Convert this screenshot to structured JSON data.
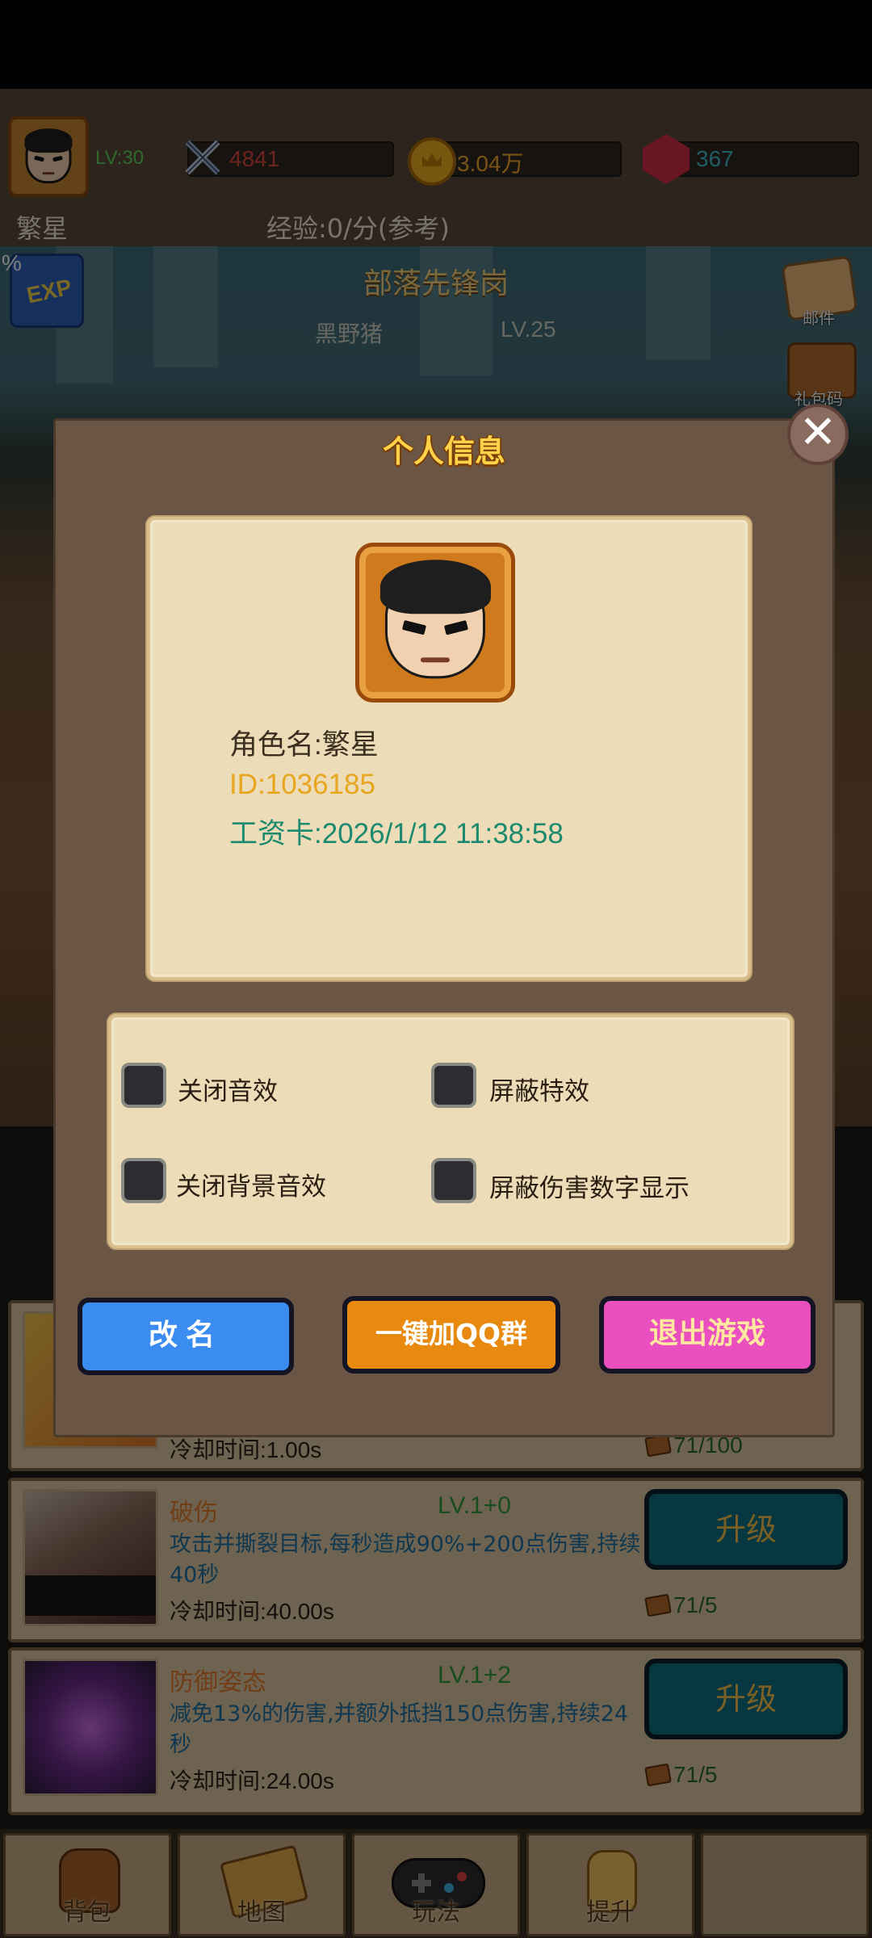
{
  "hud": {
    "level": "LV:30",
    "player_name": "繁星",
    "attack": "4841",
    "gold": "3.04万",
    "gems": "367",
    "exp": "经验:0/分(参考)"
  },
  "stage": {
    "title": "部落先锋岗",
    "enemy": "黑野猪",
    "enemy_level": "LV.25",
    "exp_percent": "%",
    "exp_badge": "EXP"
  },
  "side_menu": [
    {
      "label": "邮件",
      "icon": "mail-icon"
    },
    {
      "label": "礼包码",
      "icon": "treasure-chest-icon"
    }
  ],
  "dialog": {
    "title": "个人信息",
    "character_name": "角色名:繁星",
    "id": "ID:1036185",
    "salary_card": "工资卡:2026/1/12 11:38:58",
    "options": {
      "mute_sfx": "关闭音效",
      "hide_effects": "屏蔽特效",
      "mute_bgm": "关闭背景音效",
      "hide_damage_numbers": "屏蔽伤害数字显示"
    },
    "buttons": {
      "rename": "改名",
      "join_qq": "一键加QQ群",
      "exit": "退出游戏"
    }
  },
  "skills": [
    {
      "name": "",
      "level": "",
      "description": "",
      "cooldown": "冷却时间:1.00s",
      "cost": "71/100",
      "button": ""
    },
    {
      "name": "破伤",
      "level": "LV.1+0",
      "description": "攻击并撕裂目标,每秒造成90%+200点伤害,持续40秒",
      "cooldown": "冷却时间:40.00s",
      "cost": "71/5",
      "button": "升级"
    },
    {
      "name": "防御姿态",
      "level": "LV.1+2",
      "description": "减免13%的伤害,并额外抵挡150点伤害,持续24秒",
      "cooldown": "冷却时间:24.00s",
      "cost": "71/5",
      "button": "升级"
    }
  ],
  "nav": [
    {
      "label": "背包",
      "icon": "backpack-icon"
    },
    {
      "label": "地图",
      "icon": "map-scroll-icon"
    },
    {
      "label": "玩法",
      "icon": "gamepad-icon"
    },
    {
      "label": "提升",
      "icon": "fist-icon"
    }
  ],
  "colors": {
    "dialog_bg": "#6b5545",
    "parchment": "#ecdcb8",
    "rename_btn": "#3a8cf0",
    "qq_btn": "#e88a10",
    "exit_btn": "#ea4fc0",
    "upgrade_btn": "#0e6e80"
  }
}
